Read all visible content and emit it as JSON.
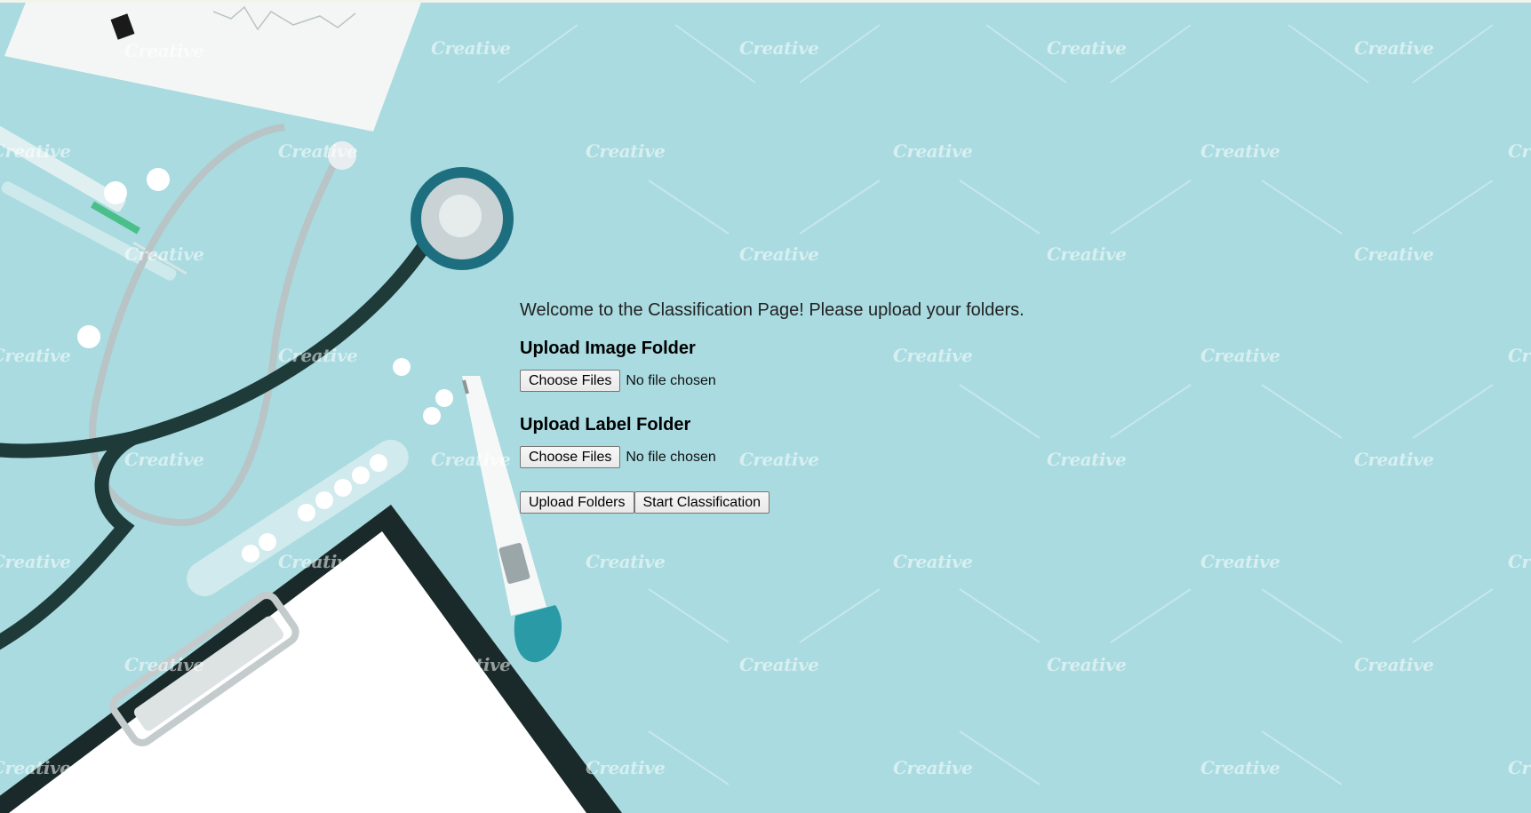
{
  "welcome_text": "Welcome to the Classification Page! Please upload your folders.",
  "image_folder": {
    "title": "Upload Image Folder",
    "button_label": "Choose Files",
    "status_text": "No file chosen"
  },
  "label_folder": {
    "title": "Upload Label Folder",
    "button_label": "Choose Files",
    "status_text": "No file chosen"
  },
  "actions": {
    "upload_label": "Upload Folders",
    "start_label": "Start Classification"
  },
  "watermark_text": "Creative",
  "colors": {
    "background": "#a9dbe0",
    "stethoscope": "#1e3b3a",
    "thermometer_cap": "#2a9aa7"
  }
}
